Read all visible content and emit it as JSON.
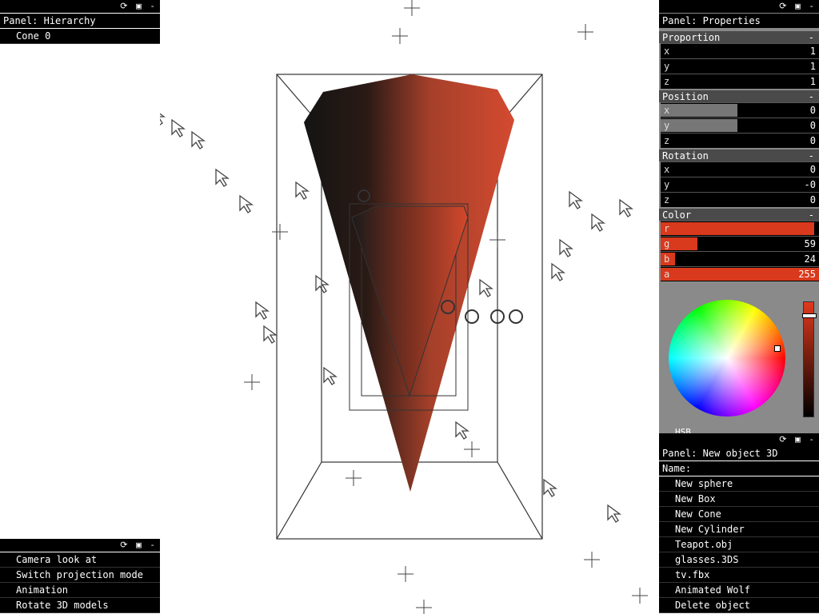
{
  "hierarchy": {
    "title": "Panel: Hierarchy",
    "items": [
      "Cone 0"
    ]
  },
  "commands": {
    "items": [
      "Camera look at",
      "Switch projection mode",
      "Animation",
      "Rotate 3D models"
    ]
  },
  "properties": {
    "title": "Panel: Properties",
    "proportion": {
      "label": "Proportion",
      "x": "1",
      "y": "1",
      "z": "1"
    },
    "position": {
      "label": "Position",
      "x": "0",
      "y": "0",
      "z": "0"
    },
    "rotation": {
      "label": "Rotation",
      "x": "0",
      "y": "-0",
      "z": "0"
    },
    "color": {
      "label": "Color",
      "r": "",
      "g": "59",
      "b": "24",
      "a": "255",
      "r_value": 0.97,
      "g_value": 0.23,
      "b_value": 0.09,
      "a_value": 1.0,
      "swatch": "#d9391c",
      "mode_label": "HSB"
    },
    "axis_labels": {
      "x": "x",
      "y": "y",
      "z": "z",
      "r": "r",
      "g": "g",
      "b": "b",
      "a": "a"
    }
  },
  "new_object": {
    "title": "Panel: New object 3D",
    "name_label": "Name:",
    "items": [
      "New sphere",
      "New Box",
      "New Cone",
      "New Cylinder",
      "Teapot.obj",
      "glasses.3DS",
      "tv.fbx",
      "Animated Wolf",
      "Delete object"
    ]
  },
  "icons": {
    "refresh": "refresh-icon",
    "save": "save-icon",
    "minimize": "minimize-icon"
  },
  "colors": {
    "cone": "#c8432a",
    "panel_bg": "#000000",
    "section_bg": "#4a4a4a"
  }
}
